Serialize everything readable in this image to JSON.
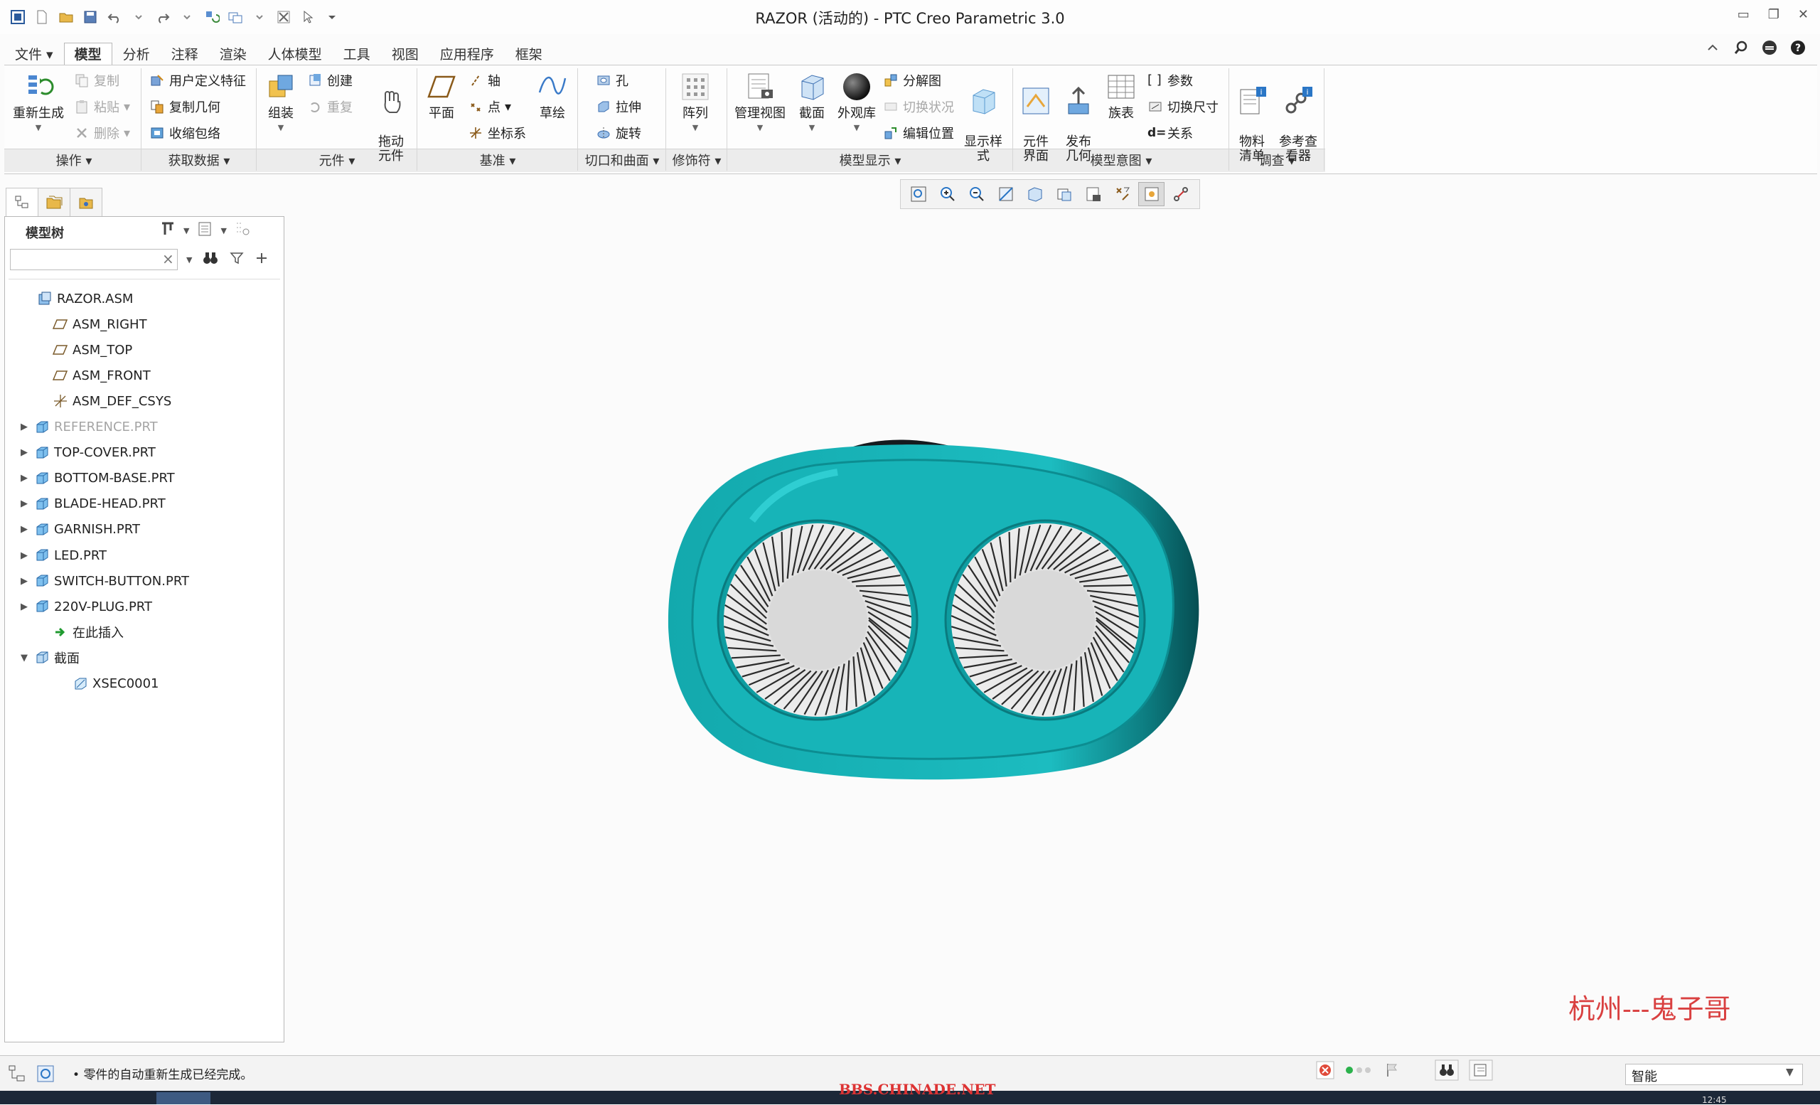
{
  "window": {
    "title": "RAZOR (活动的) - PTC Creo Parametric 3.0",
    "controls": [
      "minimize",
      "restore",
      "close"
    ]
  },
  "ribbon": {
    "tabs": [
      {
        "label": "文件",
        "dropdown": true
      },
      {
        "label": "模型",
        "active": true
      },
      {
        "label": "分析"
      },
      {
        "label": "注释"
      },
      {
        "label": "渲染"
      },
      {
        "label": "人体模型"
      },
      {
        "label": "工具"
      },
      {
        "label": "视图"
      },
      {
        "label": "应用程序"
      },
      {
        "label": "框架"
      }
    ],
    "groups": {
      "operations": "操作",
      "get_data": "获取数据",
      "component": "元件",
      "datum": "基准",
      "cut_surface": "切口和曲面",
      "modifiers": "修饰符",
      "model_display": "模型显示",
      "model_intent": "模型意图",
      "investigate": "调查"
    },
    "buttons": {
      "regenerate": "重新生成",
      "copy": "复制",
      "paste": "粘贴",
      "delete": "删除",
      "user_defined_feature": "用户定义特征",
      "copy_geometry": "复制几何",
      "shrinkwrap": "收缩包络",
      "assemble": "组装",
      "create": "创建",
      "repeat": "重复",
      "drag_components": "拖动\n元件",
      "plane": "平面",
      "axis": "轴",
      "point": "点",
      "csys": "坐标系",
      "sketch": "草绘",
      "hole": "孔",
      "extrude": "拉伸",
      "revolve": "旋转",
      "pattern": "阵列",
      "manage_views": "管理视图",
      "section": "截面",
      "appearance_gallery": "外观库",
      "exploded_view": "分解图",
      "toggle_status": "切换状况",
      "edit_position": "编辑位置",
      "display_style": "显示样\n式",
      "component_interface": "元件\n界面",
      "publish_geometry": "发布\n几何",
      "family_table": "族表",
      "parameters": "参数",
      "switch_dimensions": "切换尺寸",
      "relations": "关系",
      "bill_of_materials": "物料\n清单",
      "reference_viewer": "参考查\n看器"
    }
  },
  "model_tree": {
    "header": "模型树",
    "search_value": "",
    "items": [
      {
        "label": "RAZOR.ASM",
        "icon": "assembly-icon",
        "level": 0,
        "expand": ""
      },
      {
        "label": "ASM_RIGHT",
        "icon": "datum-plane-icon",
        "level": 1,
        "expand": ""
      },
      {
        "label": "ASM_TOP",
        "icon": "datum-plane-icon",
        "level": 1,
        "expand": ""
      },
      {
        "label": "ASM_FRONT",
        "icon": "datum-plane-icon",
        "level": 1,
        "expand": ""
      },
      {
        "label": "ASM_DEF_CSYS",
        "icon": "csys-icon",
        "level": 1,
        "expand": ""
      },
      {
        "label": "REFERENCE.PRT",
        "icon": "part-icon",
        "level": 1,
        "expand": "▶",
        "dim": true
      },
      {
        "label": "TOP-COVER.PRT",
        "icon": "part-icon",
        "level": 1,
        "expand": "▶"
      },
      {
        "label": "BOTTOM-BASE.PRT",
        "icon": "part-icon",
        "level": 1,
        "expand": "▶"
      },
      {
        "label": "BLADE-HEAD.PRT",
        "icon": "part-icon",
        "level": 1,
        "expand": "▶"
      },
      {
        "label": "GARNISH.PRT",
        "icon": "part-icon",
        "level": 1,
        "expand": "▶"
      },
      {
        "label": "LED.PRT",
        "icon": "part-icon",
        "level": 1,
        "expand": "▶"
      },
      {
        "label": "SWITCH-BUTTON.PRT",
        "icon": "part-icon",
        "level": 1,
        "expand": "▶"
      },
      {
        "label": "220V-PLUG.PRT",
        "icon": "part-icon",
        "level": 1,
        "expand": "▶"
      },
      {
        "label": "在此插入",
        "icon": "insert-here-icon",
        "level": 1,
        "expand": ""
      },
      {
        "label": "截面",
        "icon": "section-folder-icon",
        "level": 1,
        "expand": "▼"
      },
      {
        "label": "XSEC0001",
        "icon": "section-icon",
        "level": 2,
        "expand": ""
      }
    ]
  },
  "canvas": {
    "watermark": "杭州---鬼子哥",
    "model_colors": {
      "body": "#1fb5b8",
      "body_dark": "#0a6f73",
      "rim": "#0d8d91",
      "foil": "#d9d9d9"
    }
  },
  "status": {
    "message": "零件的自动重新生成已经完成。",
    "selection_filter": "智能",
    "forum_watermark": "BBS.CHINADE.NET",
    "clock": "12:45"
  },
  "colors": {
    "accent": "#2a76c6",
    "ribbon_group_bar": "#ececec",
    "watermark": "#d94040"
  }
}
